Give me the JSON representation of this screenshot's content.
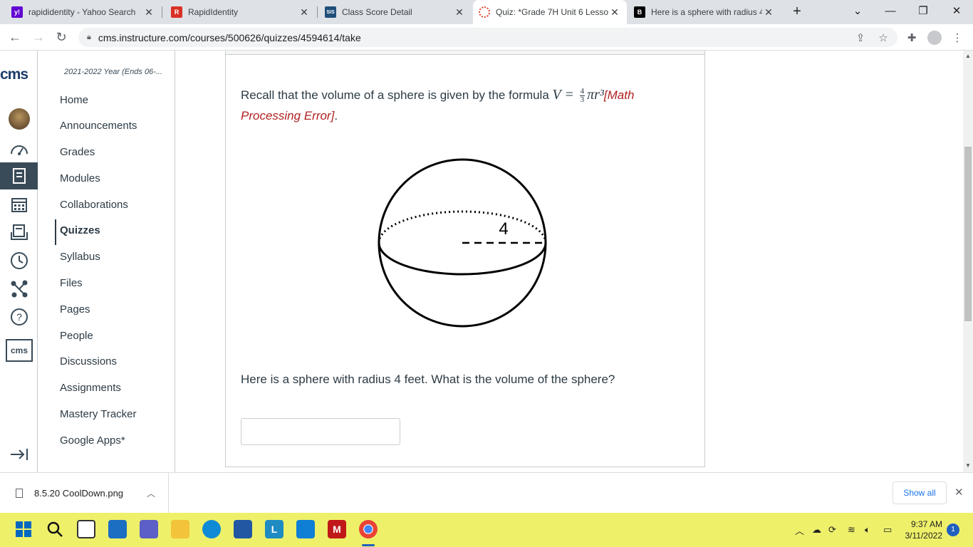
{
  "browser": {
    "tabs": [
      {
        "title": "rapididentity - Yahoo Search",
        "favicon": "yahoo-favicon-icon",
        "color": "#6001d2",
        "glyph": "y!"
      },
      {
        "title": "RapidIdentity",
        "favicon": "rapididentity-favicon-icon",
        "color": "#d93025",
        "glyph": "✉"
      },
      {
        "title": "Class Score Detail",
        "favicon": "sis-favicon-icon",
        "color": "#1f4e79",
        "glyph": "SIS"
      },
      {
        "title": "Quiz: *Grade 7H Unit 6 Lesso",
        "favicon": "canvas-favicon-icon",
        "color": "#e03e2d",
        "glyph": "◌"
      },
      {
        "title": "Here is a sphere with radius 4",
        "favicon": "brainly-favicon-icon",
        "color": "#000000",
        "glyph": "B"
      }
    ],
    "url": "cms.instructure.com/courses/500626/quizzes/4594614/take"
  },
  "global_nav": {
    "logo": "cms",
    "items": [
      "account",
      "dashboard",
      "courses",
      "calendar",
      "inbox",
      "history",
      "commons",
      "help",
      "cms-apps"
    ]
  },
  "course_nav": {
    "term": "2021-2022 Year (Ends 06-...",
    "items": [
      "Home",
      "Announcements",
      "Grades",
      "Modules",
      "Collaborations",
      "Quizzes",
      "Syllabus",
      "Files",
      "Pages",
      "People",
      "Discussions",
      "Assignments",
      "Mastery Tracker",
      "Google Apps*"
    ],
    "active": "Quizzes"
  },
  "quiz": {
    "intro": "Recall that the volume of a sphere is given by the formula ",
    "formula_lhs": "V =",
    "frac_num": "4",
    "frac_den": "3",
    "formula_rhs": "πr³",
    "error_text": "[Math Processing Error]",
    "period": ".",
    "figure_label": "4",
    "question": "Here is a sphere with radius 4 feet. What is the volume of the sphere?",
    "answer_value": ""
  },
  "downloads": {
    "file_name": "8.5.20 CoolDown.png",
    "show_all": "Show all"
  },
  "taskbar": {
    "time": "9:37 AM",
    "date": "3/11/2022",
    "notifications": "1"
  }
}
